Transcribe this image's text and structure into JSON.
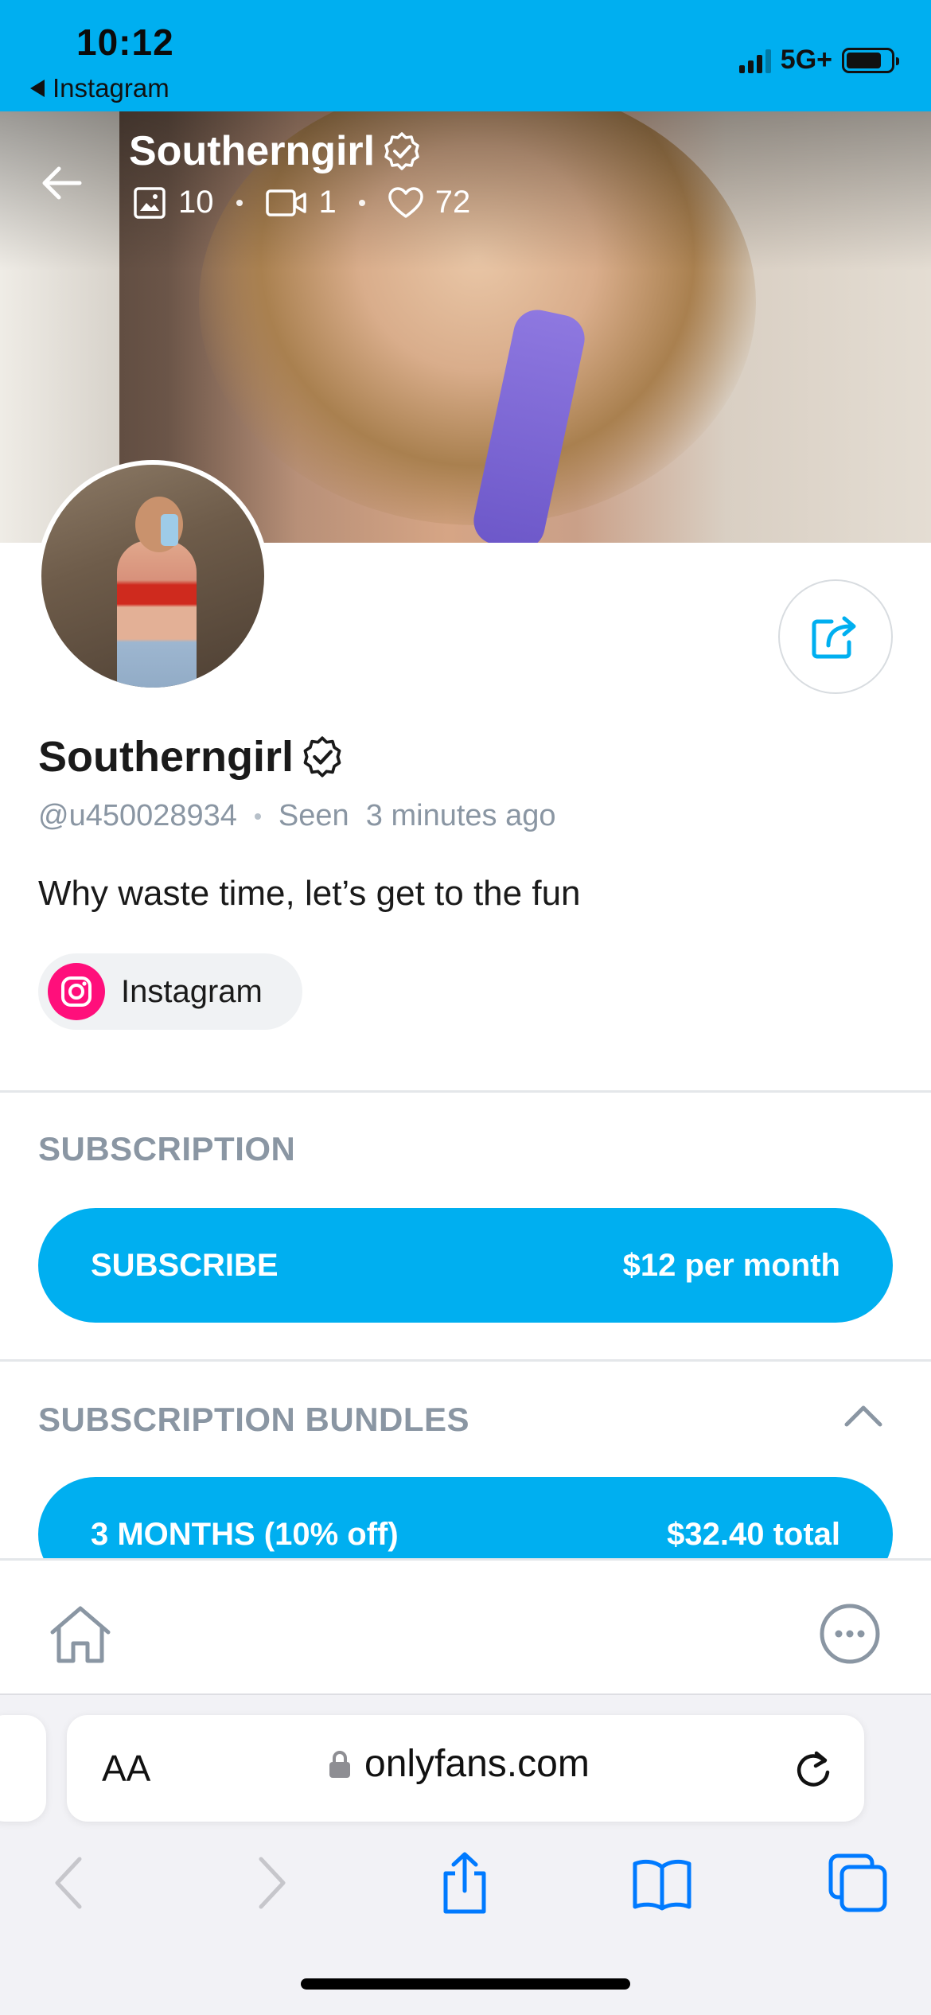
{
  "status_bar": {
    "time": "10:12",
    "back_app": "Instagram",
    "network": "5G+"
  },
  "cover": {
    "name": "Southerngirl",
    "stats": {
      "photos": "10",
      "videos": "1",
      "likes": "72"
    }
  },
  "profile": {
    "name": "Southerngirl",
    "handle": "@u450028934",
    "seen": "Seen  3 minutes ago",
    "bio": "Why waste time, let’s get to the fun",
    "link_label": "Instagram"
  },
  "subscription": {
    "title": "SUBSCRIPTION",
    "button_label": "SUBSCRIBE",
    "price": "$12 per month"
  },
  "bundles": {
    "title": "SUBSCRIPTION BUNDLES",
    "items": [
      {
        "label": "3 MONTHS (10% off)",
        "price": "$32.40 total"
      }
    ]
  },
  "browser": {
    "text_size_label": "AA",
    "url": "onlyfans.com"
  },
  "colors": {
    "accent": "#00aff0",
    "muted_text": "#8a96a3",
    "instagram": "#ff0f7b"
  }
}
